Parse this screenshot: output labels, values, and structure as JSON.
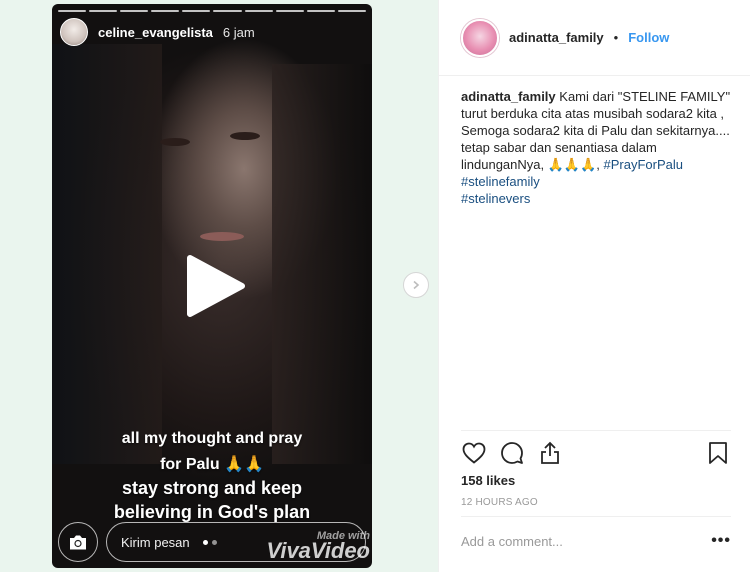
{
  "story": {
    "username": "celine_evangelista",
    "time": "6 jam",
    "caption_line1": "all my thought and pray",
    "caption_line2": "for Palu 🙏🙏",
    "caption_line3": "stay strong and keep",
    "caption_line4": "believing in God's plan",
    "message_placeholder": "Kirim pesan",
    "watermark_small": "Made with",
    "watermark": "VivaVideo",
    "icons": {
      "play": "play-icon",
      "camera": "camera-icon",
      "next": "chevron-right-icon"
    }
  },
  "post": {
    "username": "adinatta_family",
    "separator": "•",
    "follow_label": "Follow",
    "caption_user": "adinatta_family",
    "caption_text": " Kami dari \"STELINE FAMILY\" turut berduka cita atas musibah sodara2 kita , Semoga sodara2 kita di Palu dan sekitarnya.... tetap sabar dan senantiasa dalam lindunganNya, 🙏🙏🙏, ",
    "hashtag1": "#PrayForPalu",
    "hashtag2": "#stelinefamily",
    "hashtag3": "#stelinevers",
    "likes": "158 likes",
    "time_ago": "12 HOURS AGO",
    "comment_placeholder": "Add a comment...",
    "more_label": "•••",
    "icons": {
      "like": "heart-icon",
      "comment": "comment-icon",
      "share": "share-icon",
      "save": "bookmark-icon"
    }
  },
  "colors": {
    "link_blue": "#3897f0",
    "hashtag": "#1a4f80",
    "text": "#262626",
    "muted": "#999999"
  }
}
